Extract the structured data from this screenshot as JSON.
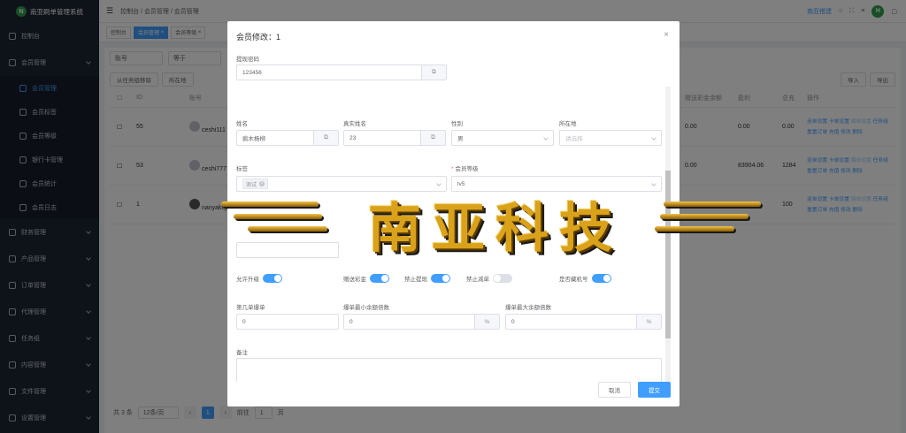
{
  "app": {
    "title": "南亚刷单管理系统",
    "logo_letter": "N"
  },
  "sidebar": {
    "items": [
      {
        "label": "控制台"
      },
      {
        "label": "会员管理"
      },
      {
        "label": "财务管理"
      },
      {
        "label": "产品管理"
      },
      {
        "label": "订单管理"
      },
      {
        "label": "代理管理"
      },
      {
        "label": "任务组"
      },
      {
        "label": "内容管理"
      },
      {
        "label": "文件管理"
      },
      {
        "label": "设置管理"
      }
    ],
    "sub_items": [
      {
        "label": "会员管理"
      },
      {
        "label": "会员标签"
      },
      {
        "label": "会员等级"
      },
      {
        "label": "银行卡管理"
      },
      {
        "label": "会员统计"
      },
      {
        "label": "会员日志"
      }
    ]
  },
  "topbar": {
    "crumbs": [
      "控制台",
      "会员管理",
      "会员管理"
    ],
    "sep": "/",
    "site": "南亚搭建",
    "avatar_letter": "H"
  },
  "tabs": [
    {
      "label": "控制台"
    },
    {
      "label": "会员管理"
    },
    {
      "label": "会员等级"
    }
  ],
  "filters": {
    "field": "账号",
    "op": "等于"
  },
  "toolbar": {
    "remove_group": "从任务组移除",
    "location": "所在地",
    "import": "导入",
    "export": "导出"
  },
  "table": {
    "headers": [
      "ID",
      "账号",
      "赠送彩金余额",
      "盈利",
      "总充",
      "操作"
    ],
    "rows": [
      {
        "id": "55",
        "account": "ceshi111",
        "bonus": "0.00",
        "profit": "0.00",
        "total": "0.00"
      },
      {
        "id": "53",
        "account": "ceshi777",
        "bonus": "0.00",
        "profit": "83904.06",
        "total": "1284"
      },
      {
        "id": "1",
        "account": "nanyakeji1",
        "bonus": "",
        "profit": "",
        "total": "100"
      }
    ],
    "ops_row1": [
      "连单设置",
      "卡单设置",
      "爆单设置",
      "任务组"
    ],
    "ops_row2": [
      "重置订单",
      "充值",
      "修改",
      "删除"
    ]
  },
  "pager": {
    "total": "共 3 条",
    "size": "12条/页",
    "current": "1",
    "goto": "前往",
    "page_input": "1",
    "page_suffix": "页"
  },
  "dialog": {
    "title": "会员修改：1",
    "fields": {
      "withdraw_pwd": {
        "label": "提现密码",
        "value": "123456"
      },
      "name": {
        "label": "姓名",
        "value": "疯木杨柳"
      },
      "real_name": {
        "label": "真实姓名",
        "value": "23"
      },
      "gender": {
        "label": "性别",
        "value": "男"
      },
      "location": {
        "label": "所在地",
        "placeholder": "请选择"
      },
      "tags": {
        "label": "标签",
        "chip": "测试"
      },
      "level": {
        "label": "会员等级",
        "value": "lv5"
      },
      "nth_order": {
        "label": "第几单爆单",
        "value": "0"
      },
      "min_mult": {
        "label": "爆单最小余额倍数",
        "value": "0",
        "unit": "%"
      },
      "max_mult": {
        "label": "爆单最大余额倍数",
        "value": "0",
        "unit": "%"
      },
      "remark": {
        "label": "备注"
      }
    },
    "switches": [
      {
        "label": "允许升级",
        "on": true
      },
      {
        "label": "赠送彩金",
        "on": true
      },
      {
        "label": "禁止提现",
        "on": true
      },
      {
        "label": "禁止减单",
        "on": false
      },
      {
        "label": "是否藏机号",
        "on": true
      }
    ],
    "cancel": "取消",
    "submit": "提交"
  },
  "watermark": {
    "text": "南亚科技"
  }
}
